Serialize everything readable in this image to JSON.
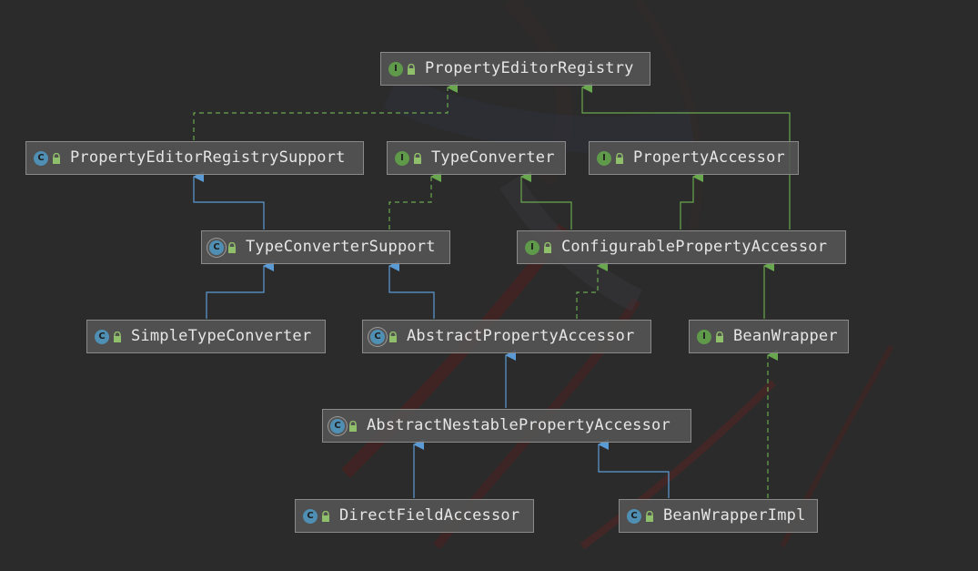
{
  "colors": {
    "background": "#2b2b2b",
    "node_fill": "#555555",
    "node_border": "#8a8a8a",
    "interface_badge": "#5f9a4a",
    "class_badge": "#4f8fb3",
    "implements_edge": "#6aa84f",
    "extends_edge": "#5b9bd5",
    "text": "#e6e6e6"
  },
  "nodes": {
    "property_editor_registry": {
      "label": "PropertyEditorRegistry",
      "kind": "interface",
      "badge": "I"
    },
    "property_editor_registry_support": {
      "label": "PropertyEditorRegistrySupport",
      "kind": "class",
      "badge": "C"
    },
    "type_converter": {
      "label": "TypeConverter",
      "kind": "interface",
      "badge": "I"
    },
    "property_accessor": {
      "label": "PropertyAccessor",
      "kind": "interface",
      "badge": "I"
    },
    "type_converter_support": {
      "label": "TypeConverterSupport",
      "kind": "abstract",
      "badge": "C"
    },
    "configurable_property_accessor": {
      "label": "ConfigurablePropertyAccessor",
      "kind": "interface",
      "badge": "I"
    },
    "simple_type_converter": {
      "label": "SimpleTypeConverter",
      "kind": "class",
      "badge": "C"
    },
    "abstract_property_accessor": {
      "label": "AbstractPropertyAccessor",
      "kind": "abstract",
      "badge": "C"
    },
    "bean_wrapper": {
      "label": "BeanWrapper",
      "kind": "interface",
      "badge": "I"
    },
    "abstract_nestable_property_accessor": {
      "label": "AbstractNestablePropertyAccessor",
      "kind": "abstract",
      "badge": "C"
    },
    "direct_field_accessor": {
      "label": "DirectFieldAccessor",
      "kind": "class",
      "badge": "C"
    },
    "bean_wrapper_impl": {
      "label": "BeanWrapperImpl",
      "kind": "class",
      "badge": "C"
    }
  }
}
